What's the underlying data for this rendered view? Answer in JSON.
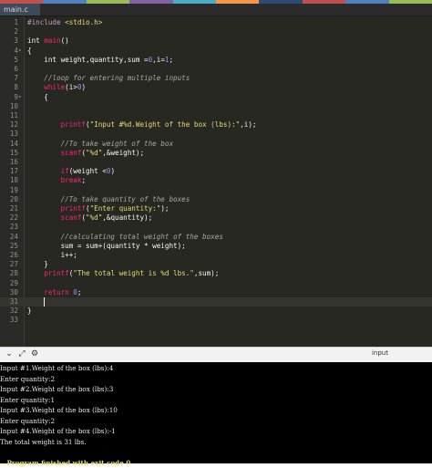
{
  "colors": {
    "top_strip": [
      "#c0504d",
      "#4f81bd",
      "#9bbb59",
      "#8064a2",
      "#4bacc6",
      "#f79646",
      "#2c4d75",
      "#c0504d",
      "#4f81bd",
      "#9bbb59"
    ],
    "editor_bg": "#272822",
    "console_bg": "#000000",
    "exit_text": "#e6db74"
  },
  "tab": {
    "filename": "main.c"
  },
  "editor": {
    "line_numbers": [
      "1",
      "2",
      "3",
      "4",
      "5",
      "6",
      "7",
      "8",
      "9",
      "10",
      "11",
      "12",
      "13",
      "14",
      "15",
      "16",
      "17",
      "18",
      "19",
      "20",
      "21",
      "22",
      "23",
      "24",
      "25",
      "26",
      "27",
      "28",
      "29",
      "30",
      "31",
      "32",
      "33"
    ],
    "fold_markers": {
      "4": "▾",
      "9": "▾"
    },
    "active_line": 31,
    "lines": [
      [
        [
          "pp",
          "#include "
        ],
        [
          "str",
          "<stdio.h>"
        ]
      ],
      [],
      [
        [
          "ty",
          "int "
        ],
        [
          "fn",
          "main"
        ],
        [
          "ty",
          "()"
        ]
      ],
      [
        [
          "ty",
          "{"
        ]
      ],
      [
        [
          "ty",
          "    int weight,quantity,sum ="
        ],
        [
          "num",
          "0"
        ],
        [
          "ty",
          ",i="
        ],
        [
          "num",
          "1"
        ],
        [
          "ty",
          ";"
        ]
      ],
      [],
      [
        [
          "cm",
          "    //loop for entering multiple inputs"
        ]
      ],
      [
        [
          "kw",
          "    while"
        ],
        [
          "ty",
          "(i>"
        ],
        [
          "num",
          "0"
        ],
        [
          "ty",
          ")"
        ]
      ],
      [
        [
          "ty",
          "    {"
        ]
      ],
      [],
      [],
      [
        [
          "fn",
          "        printf"
        ],
        [
          "ty",
          "("
        ],
        [
          "str",
          "\"Input #%d.Weight of the box (lbs):\""
        ],
        [
          "ty",
          ",i);"
        ]
      ],
      [],
      [
        [
          "cm",
          "        //To take weight of the box"
        ]
      ],
      [
        [
          "fn",
          "        scanf"
        ],
        [
          "ty",
          "("
        ],
        [
          "str",
          "\"%d\""
        ],
        [
          "ty",
          ",&weight);"
        ]
      ],
      [],
      [
        [
          "kw",
          "        if"
        ],
        [
          "ty",
          "(weight <"
        ],
        [
          "num",
          "0"
        ],
        [
          "ty",
          ")"
        ]
      ],
      [
        [
          "kw",
          "        break"
        ],
        [
          "ty",
          ";"
        ]
      ],
      [],
      [
        [
          "cm",
          "        //To take quantity of the boxes"
        ]
      ],
      [
        [
          "fn",
          "        printf"
        ],
        [
          "ty",
          "("
        ],
        [
          "str",
          "\"Enter quantity:\""
        ],
        [
          "ty",
          ");"
        ]
      ],
      [
        [
          "fn",
          "        scanf"
        ],
        [
          "ty",
          "("
        ],
        [
          "str",
          "\"%d\""
        ],
        [
          "ty",
          ",&quantity);"
        ]
      ],
      [],
      [
        [
          "cm",
          "        //calculating total weight of the boxes"
        ]
      ],
      [
        [
          "ty",
          "        sum = sum+(quantity * weight);"
        ]
      ],
      [
        [
          "ty",
          "        i++;"
        ]
      ],
      [
        [
          "ty",
          "    }"
        ]
      ],
      [
        [
          "fn",
          "    printf"
        ],
        [
          "ty",
          "("
        ],
        [
          "str",
          "\"The total weight is %d lbs.\""
        ],
        [
          "ty",
          ",sum);"
        ]
      ],
      [],
      [
        [
          "kw",
          "    return "
        ],
        [
          "num",
          "0"
        ],
        [
          "ty",
          ";"
        ]
      ],
      [],
      [
        [
          "ty",
          "}"
        ]
      ],
      []
    ]
  },
  "toolbar": {
    "collapse_icon": "chevron-down-icon",
    "expand_icon": "expand-icon",
    "settings_icon": "gear-icon",
    "input_label": "input"
  },
  "console": {
    "lines": [
      "Input #1.Weight of the box (lbs):4",
      "Enter quantity:2",
      "Input #2.Weight of the box (lbs):3",
      "Enter quantity:1",
      "Input #3.Weight of the box (lbs):10",
      "Enter quantity:2",
      "Input #4.Weight of the box (lbs):-1",
      "The total weight is 31 lbs.",
      "",
      "...Program finished with exit code 0"
    ]
  }
}
